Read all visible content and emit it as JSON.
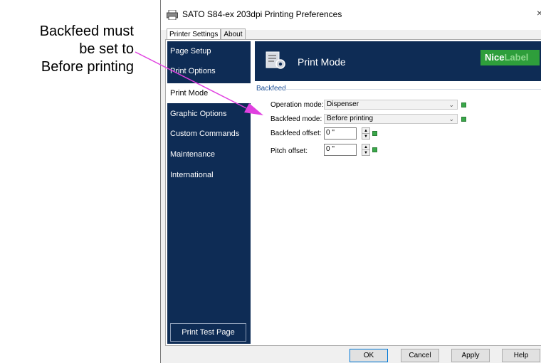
{
  "annotation": {
    "line1": "Backfeed must",
    "line2": "be set to",
    "line3": "Before printing"
  },
  "window": {
    "title": "SATO S84-ex 203dpi Printing Preferences",
    "close": "×"
  },
  "tabs": [
    "Printer Settings",
    "About"
  ],
  "sidebar": {
    "items": [
      {
        "label": "Page Setup"
      },
      {
        "label": "Print Options"
      },
      {
        "label": "Print Mode"
      },
      {
        "label": "Graphic Options"
      },
      {
        "label": "Custom Commands"
      },
      {
        "label": "Maintenance"
      },
      {
        "label": "International"
      }
    ],
    "print_test": "Print Test Page"
  },
  "header": {
    "title": "Print Mode",
    "logo_part1": "Nice",
    "logo_part2": "Label"
  },
  "backfeed": {
    "group_label": "Backfeed",
    "operation_mode_label": "Operation mode:",
    "operation_mode_value": "Dispenser",
    "backfeed_mode_label": "Backfeed mode:",
    "backfeed_mode_value": "Before printing",
    "backfeed_offset_label": "Backfeed offset:",
    "backfeed_offset_value": "0 \"",
    "pitch_offset_label": "Pitch offset:",
    "pitch_offset_value": "0 \""
  },
  "buttons": {
    "ok": "OK",
    "cancel": "Cancel",
    "apply": "Apply",
    "help": "Help"
  },
  "colors": {
    "sidebar": "#0e2c55",
    "accent_arrow": "#e040e0",
    "logo": "#2e9e3b",
    "lock": "#3aa84a"
  }
}
